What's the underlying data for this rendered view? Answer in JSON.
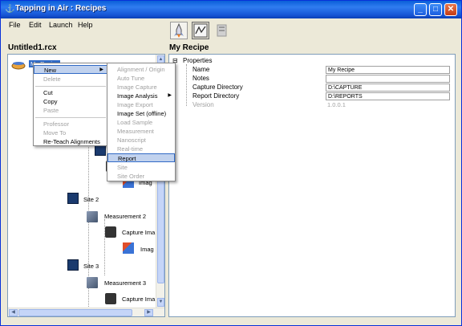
{
  "window": {
    "title": "Tapping in Air : Recipes"
  },
  "menubar": [
    "File",
    "Edit",
    "Launch",
    "Help"
  ],
  "toolbar": {
    "icons": [
      "rocket-icon",
      "graph-icon",
      "document-icon"
    ]
  },
  "left_panel": {
    "title": "Untitled1.rcx",
    "root_label": "My Recipe",
    "tree": [
      {
        "label": "Imag",
        "icon": "image-analysis-icon"
      },
      {
        "label": "Site 2",
        "icon": "site-icon"
      },
      {
        "label": "Measurement 2",
        "icon": "measurement-icon"
      },
      {
        "label": "Capture Ima",
        "icon": "camera-icon"
      },
      {
        "label": "Imag",
        "icon": "image-analysis-icon"
      },
      {
        "label": "Site 3",
        "icon": "site-icon"
      },
      {
        "label": "Measurement 3",
        "icon": "measurement-icon"
      },
      {
        "label": "Capture Ima",
        "icon": "camera-icon"
      }
    ]
  },
  "right_panel": {
    "title": "My Recipe",
    "properties_label": "Properties",
    "rows": [
      {
        "name": "Name",
        "value": "My Recipe"
      },
      {
        "name": "Notes",
        "value": ""
      },
      {
        "name": "Capture Directory",
        "value": "D:\\CAPTURE"
      },
      {
        "name": "Report Directory",
        "value": "D:\\REPORTS"
      },
      {
        "name": "Version",
        "value": "1.0.0.1"
      }
    ]
  },
  "context_menu": {
    "items": [
      "New",
      "Delete",
      "Cut",
      "Copy",
      "Paste",
      "Professor",
      "Move To",
      "Re-Teach Alignments"
    ]
  },
  "submenu": {
    "items": [
      "Alignment / Origin",
      "Auto Tune",
      "Image Capture",
      "Image Analysis",
      "Image Export",
      "Image Set (offline)",
      "Load Sample",
      "Measurement",
      "Nanoscript",
      "Real-time",
      "Report",
      "Site",
      "Site Order"
    ]
  }
}
